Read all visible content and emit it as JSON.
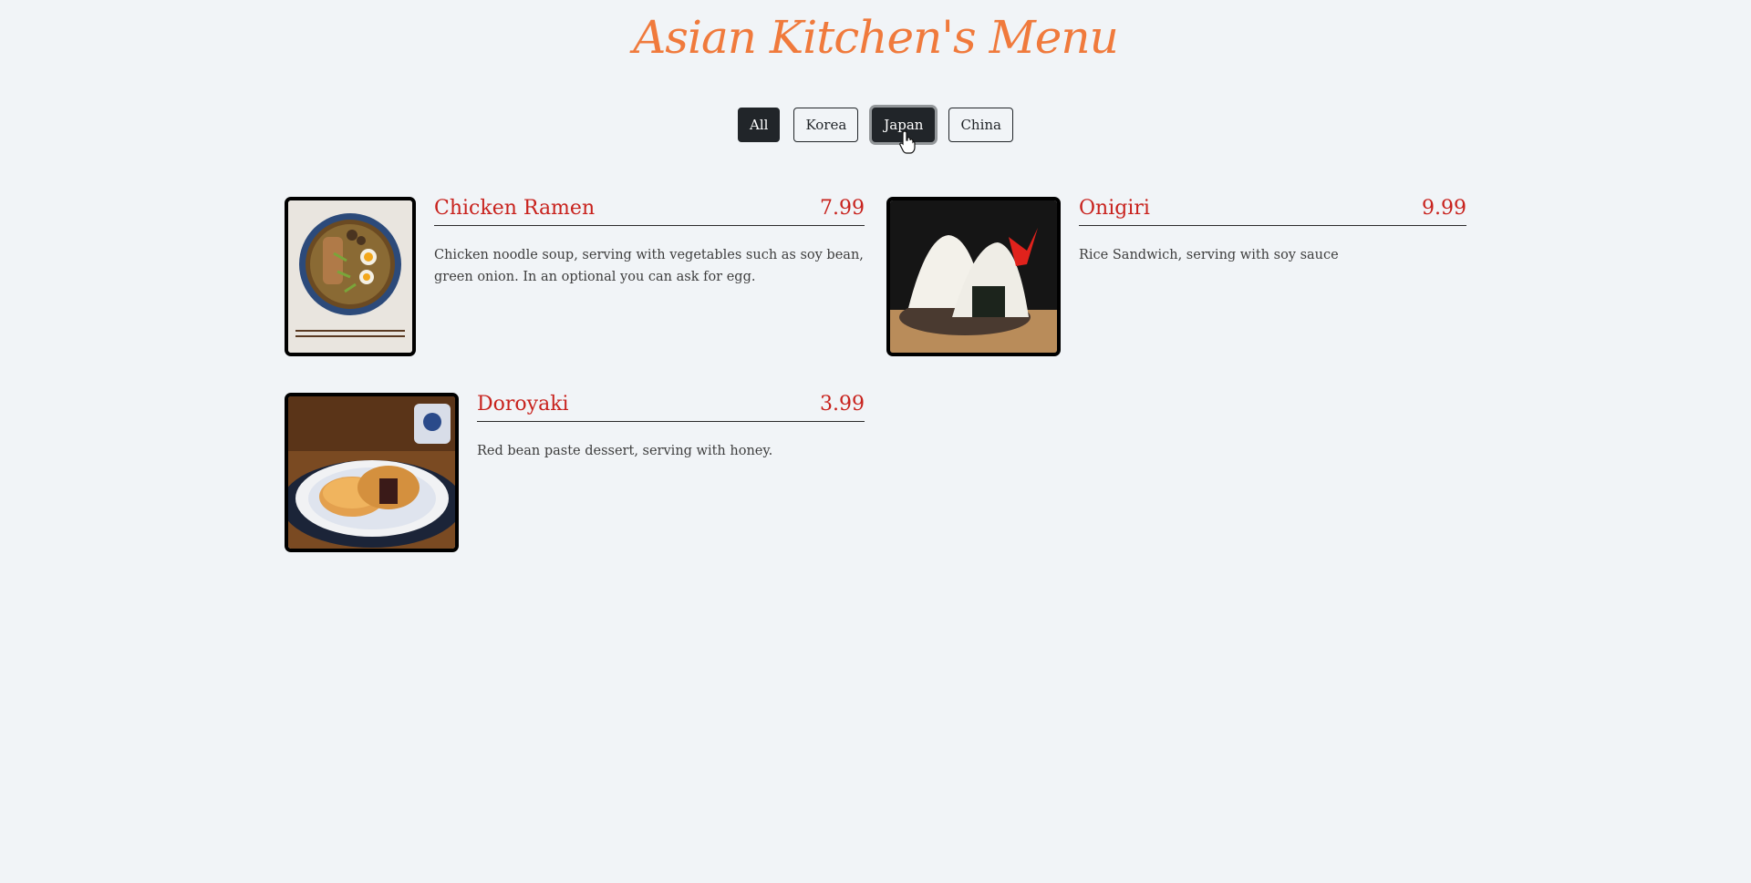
{
  "header": {
    "title": "Asian Kitchen's Menu"
  },
  "filters": [
    {
      "label": "All",
      "active": true
    },
    {
      "label": "Korea",
      "active": false
    },
    {
      "label": "Japan",
      "active": true,
      "focused": true
    },
    {
      "label": "China",
      "active": false
    }
  ],
  "menu": [
    {
      "name": "Chicken Ramen",
      "price": "7.99",
      "description": "Chicken noodle soup, serving with vegetables such as soy bean, green onion. In an optional you can ask for egg."
    },
    {
      "name": "Onigiri",
      "price": "9.99",
      "description": "Rice Sandwich, serving with soy sauce"
    },
    {
      "name": "Doroyaki",
      "price": "3.99",
      "description": "Red bean paste dessert, serving with honey."
    }
  ],
  "colors": {
    "accent": "#c8221d",
    "title": "#f07a3c",
    "button_dark": "#212529",
    "background": "#f1f4f7"
  }
}
